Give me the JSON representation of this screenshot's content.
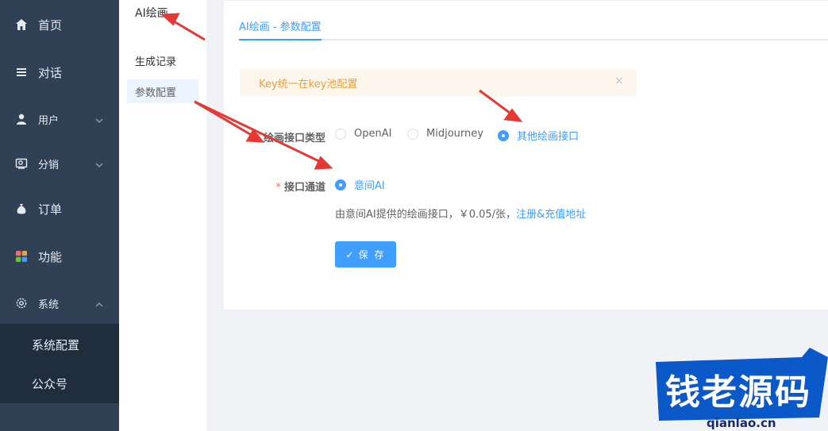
{
  "sidebar": {
    "items": [
      {
        "label": "首页",
        "icon": "home-icon"
      },
      {
        "label": "对话",
        "icon": "list-icon"
      },
      {
        "label": "用户",
        "icon": "user-icon"
      },
      {
        "label": "分销",
        "icon": "share-icon"
      },
      {
        "label": "订单",
        "icon": "money-bag-icon"
      },
      {
        "label": "功能",
        "icon": "grid-icon"
      },
      {
        "label": "系统",
        "icon": "gear-icon"
      }
    ],
    "submenu": [
      {
        "label": "系统配置"
      },
      {
        "label": "公众号"
      }
    ]
  },
  "menu2": {
    "title": "AI绘画",
    "items": [
      {
        "label": "生成记录"
      },
      {
        "label": "参数配置"
      }
    ]
  },
  "main": {
    "tab": "AI绘画 - 参数配置",
    "alert": "Key统一在key池配置",
    "form": {
      "type_label": "绘画接口类型",
      "type_options": [
        "OpenAI",
        "Midjourney",
        "其他绘画接口"
      ],
      "channel_label": "接口通道",
      "channel_option": "意间AI",
      "desc_text": "由意间AI提供的绘画接口，￥0.05/张，",
      "desc_link": "注册&充值地址",
      "save_label": "保 存"
    }
  },
  "watermark": {
    "text": "钱老源码",
    "url": "qianlao.cn"
  },
  "colors": {
    "sidebar_bg": "#304156",
    "submenu_bg": "#1f2d3d",
    "primary": "#409eff",
    "warning": "#e6a23c",
    "annotation": "#e53935"
  }
}
